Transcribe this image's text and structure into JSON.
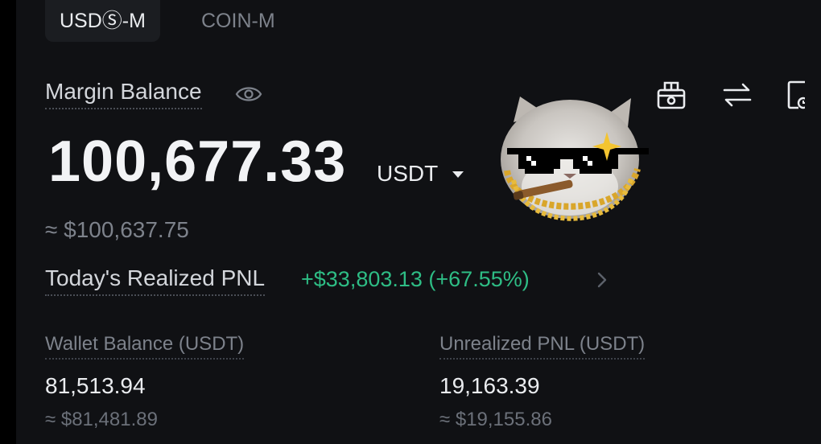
{
  "tabs": [
    {
      "label": "USDⓈ-M",
      "active": true
    },
    {
      "label": "COIN-M",
      "active": false
    }
  ],
  "margin_balance": {
    "label": "Margin Balance",
    "value": "100,677.33",
    "unit": "USDT",
    "approx": "≈ $100,637.75"
  },
  "realized_pnl": {
    "label": "Today's Realized PNL",
    "value": "+$33,803.13 (+67.55%)",
    "color": "#2ebd85"
  },
  "wallet_balance": {
    "label": "Wallet Balance (USDT)",
    "value": "81,513.94",
    "approx": "≈ $81,481.89"
  },
  "unrealized_pnl": {
    "label": "Unrealized PNL (USDT)",
    "value": "19,163.39",
    "approx": "≈ $19,155.86"
  },
  "icons": [
    "eye-icon",
    "gift-icon",
    "transfer-icon",
    "history-icon",
    "chevron-right-icon",
    "caret-down-icon"
  ],
  "colors": {
    "background": "#101114",
    "positive": "#2ebd85",
    "muted": "#7d828b"
  }
}
